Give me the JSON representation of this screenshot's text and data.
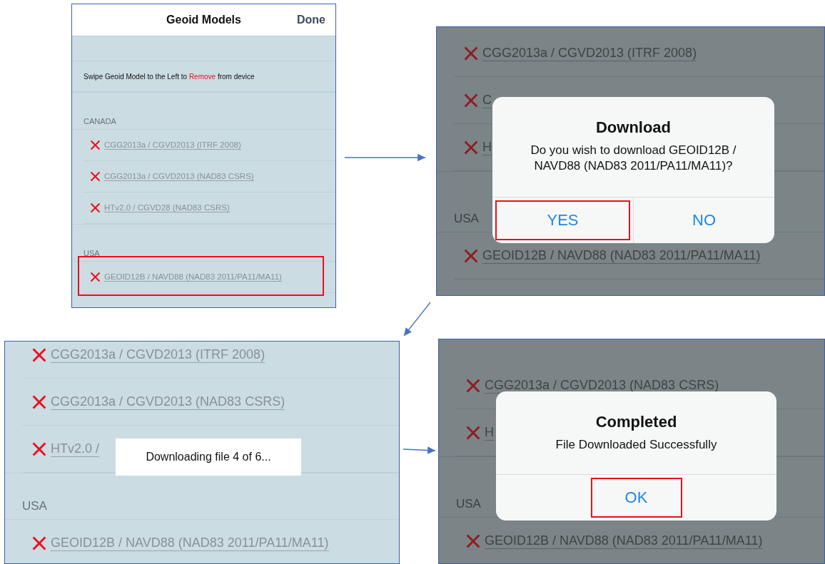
{
  "panels": [
    {
      "kind": "list",
      "nav": {
        "title": "Geoid Models",
        "done": "Done"
      },
      "hint": {
        "before": "Swipe Geoid Model to the Left to",
        "link": "Remove",
        "after": "from device"
      },
      "sections": [
        {
          "header": "CANADA",
          "rows": [
            {
              "label": "CGG2013a / CGVD2013 (ITRF 2008)",
              "highlighted": false
            },
            {
              "label": "CGG2013a / CGVD2013 (NAD83 CSRS)",
              "highlighted": false
            },
            {
              "label": "HTv2.0 / CGVD28 (NAD83 CSRS)",
              "highlighted": false
            }
          ]
        },
        {
          "header": "USA",
          "rows": [
            {
              "label": "GEOID12B / NAVD88 (NAD83 2011/PA11/MA11)",
              "highlighted": true
            }
          ]
        }
      ]
    },
    {
      "kind": "alert",
      "sections": [
        {
          "rows": [
            {
              "label": "CGG2013a / CGVD2013 (ITRF 2008)",
              "highlighted": false
            },
            {
              "label": "C",
              "highlighted": false
            },
            {
              "label": "H",
              "highlighted": false
            }
          ]
        },
        {
          "header": "USA",
          "rows": [
            {
              "label": "GEOID12B / NAVD88 (NAD83 2011/PA11/MA11)",
              "highlighted": false
            }
          ]
        }
      ],
      "dialog": {
        "title": "Download",
        "message": "Do you wish to download GEOID12B / NAVD88 (NAD83 2011/PA11/MA11)?",
        "buttons": [
          {
            "label": "YES",
            "highlighted": true
          },
          {
            "label": "NO",
            "highlighted": false
          }
        ]
      }
    },
    {
      "kind": "toast",
      "sections": [
        {
          "rows": [
            {
              "label": "CGG2013a / CGVD2013 (ITRF 2008)",
              "highlighted": false
            },
            {
              "label": "CGG2013a / CGVD2013 (NAD83 CSRS)",
              "highlighted": false
            },
            {
              "label": "HTv2.0 /",
              "highlighted": false
            }
          ]
        },
        {
          "header": "USA",
          "rows": [
            {
              "label": "GEOID12B / NAVD88 (NAD83 2011/PA11/MA11)",
              "highlighted": false
            }
          ]
        }
      ],
      "toast": "Downloading file 4 of 6..."
    },
    {
      "kind": "alert",
      "sections": [
        {
          "rows": [
            {
              "label": "CGG2013a / CGVD2013 (NAD83 CSRS)",
              "highlighted": false
            },
            {
              "label": "H",
              "highlighted": false
            }
          ]
        },
        {
          "header": "USA",
          "rows": [
            {
              "label": "GEOID12B / NAVD88 (NAD83 2011/PA11/MA11)",
              "highlighted": false
            }
          ]
        }
      ],
      "dialog": {
        "title": "Completed",
        "message": "File Downloaded Successfully",
        "buttons": [
          {
            "label": "OK",
            "highlighted": true
          }
        ]
      }
    }
  ]
}
